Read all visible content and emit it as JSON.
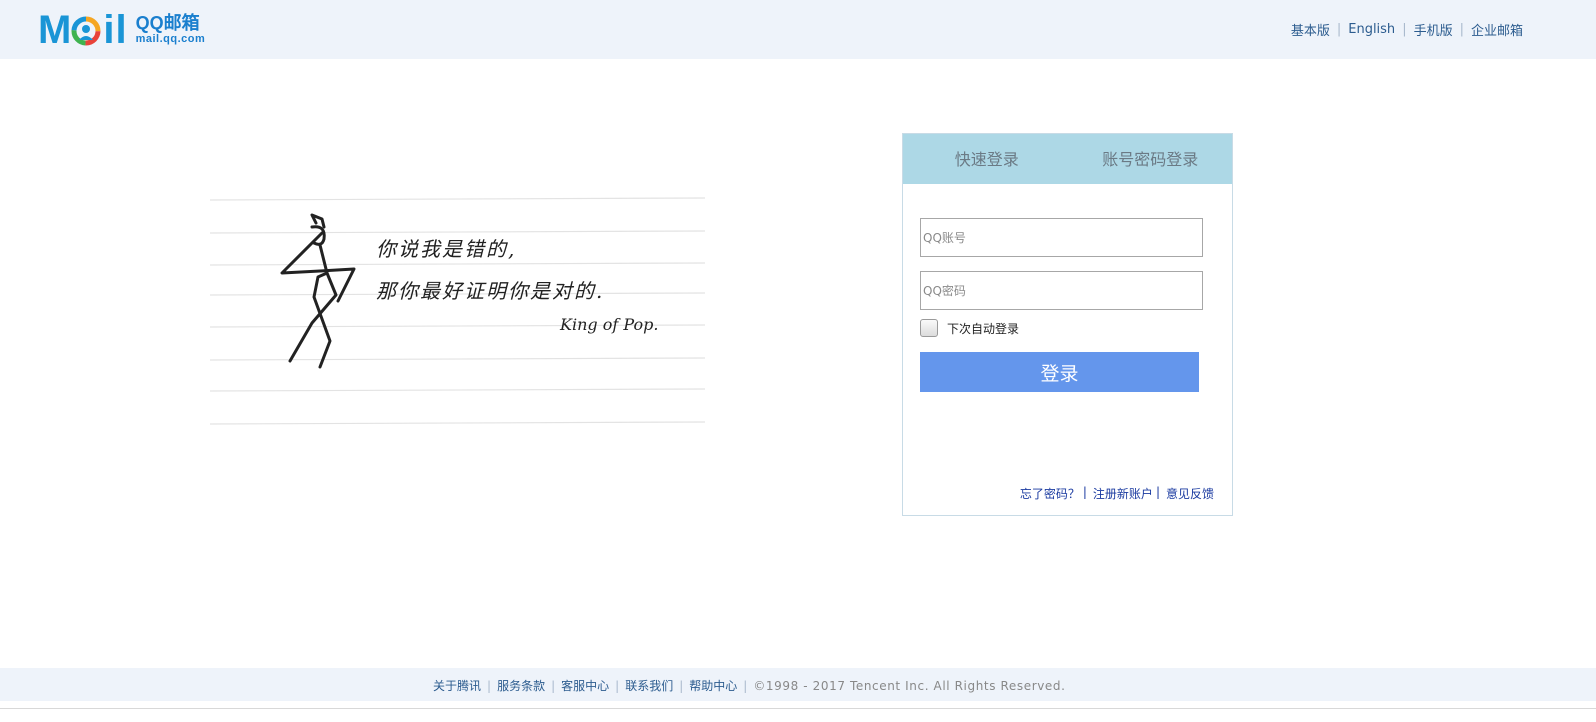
{
  "colors": {
    "header_bg": "#eef3fa",
    "logo_blue": "#1a95d6",
    "tab_bg": "#add8e6",
    "login_button": "#6496ec",
    "link": "#2c5c8f"
  },
  "logo": {
    "left_letters": "M",
    "right_letters": "il",
    "name": "QQ邮箱",
    "url": "mail.qq.com"
  },
  "header": {
    "links": [
      "基本版",
      "English",
      "手机版",
      "企业邮箱"
    ]
  },
  "illustration": {
    "line1": "你说我是错的,",
    "line2": "那你最好证明你是对的.",
    "signature": "King of Pop."
  },
  "login": {
    "tabs": [
      "快速登录",
      "账号密码登录"
    ],
    "account_placeholder": "QQ账号",
    "password_placeholder": "QQ密码",
    "remember_label": "下次自动登录",
    "submit_label": "登录",
    "links": [
      "忘了密码？",
      "注册新账户",
      "意见反馈"
    ]
  },
  "footer": {
    "links": [
      "关于腾讯",
      "服务条款",
      "客服中心",
      "联系我们",
      "帮助中心"
    ],
    "copyright": "©1998 - 2017 Tencent Inc. All Rights Reserved."
  }
}
